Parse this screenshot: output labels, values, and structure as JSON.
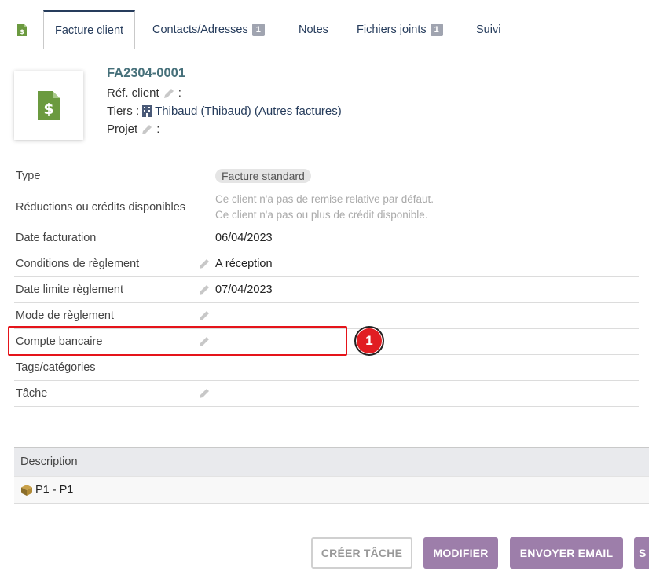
{
  "tabs": [
    {
      "label": "Facture client",
      "badge": ""
    },
    {
      "label": "Contacts/Adresses",
      "badge": "1"
    },
    {
      "label": "Notes",
      "badge": ""
    },
    {
      "label": "Fichiers joints",
      "badge": "1"
    },
    {
      "label": "Suivi",
      "badge": ""
    }
  ],
  "header": {
    "ref": "FA2304-0001",
    "ref_client_label": "Réf. client",
    "tiers_label": "Tiers :",
    "tiers_value": "Thibaud (Thibaud) (Autres factures)",
    "projet_label": "Projet",
    "colon": ":"
  },
  "fields": {
    "type_label": "Type",
    "type_value": "Facture standard",
    "reductions_label": "Réductions ou crédits disponibles",
    "reductions_line1": "Ce client n'a pas de remise relative par défaut.",
    "reductions_line2": "Ce client n'a pas ou plus de crédit disponible.",
    "date_fact_label": "Date facturation",
    "date_fact_value": "06/04/2023",
    "conditions_label": "Conditions de règlement",
    "conditions_value": "A réception",
    "date_limite_label": "Date limite règlement",
    "date_limite_value": "07/04/2023",
    "mode_label": "Mode de règlement",
    "compte_label": "Compte bancaire",
    "tags_label": "Tags/catégories",
    "tache_label": "Tâche"
  },
  "annotation": {
    "number": "1",
    "color": "#e11d22"
  },
  "lines": {
    "header": "Description",
    "rows": [
      {
        "label": "P1 - P1"
      }
    ]
  },
  "buttons": {
    "creer_tache": "CRÉER TÂCHE",
    "modifier": "MODIFIER",
    "envoyer_email": "ENVOYER EMAIL",
    "next_partial": "S"
  },
  "colors": {
    "accent": "#9d7eaa",
    "tab_text": "#263c5c",
    "ref": "#46707a",
    "icon_green": "#6b9a3f"
  }
}
